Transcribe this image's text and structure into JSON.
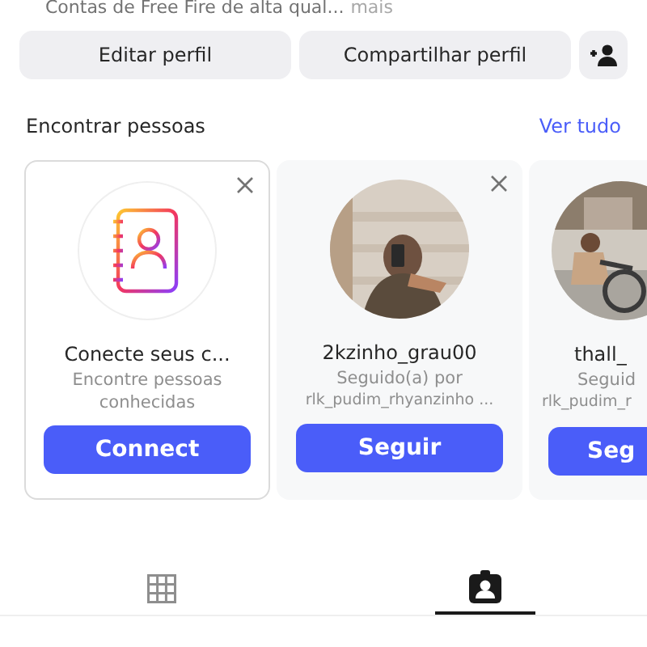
{
  "bio": {
    "text": "Contas de Free Fire de alta qual...",
    "more": "mais"
  },
  "profile_buttons": [
    "Editar perfil",
    "Compartilhar perfil"
  ],
  "section": {
    "title": "Encontrar pessoas",
    "link": "Ver tudo"
  },
  "cards": [
    {
      "kind": "contacts",
      "dismissible": true,
      "name": "Conecte seus c...",
      "subtitle": "Encontre pessoas conhecidas",
      "button": "Connect"
    },
    {
      "kind": "user",
      "dismissible": true,
      "name": "2kzinho_grau00",
      "subtitle": "Seguido(a) por",
      "detail": "rlk_pudim_rhyanzinho ...",
      "button": "Seguir"
    },
    {
      "kind": "partial",
      "name": "thall_",
      "subtitle": "Seguid",
      "detail": "rlk_pudim_r",
      "button": "Seg"
    }
  ],
  "tabs": [
    {
      "kind": "grid",
      "selected": false
    },
    {
      "kind": "tagged",
      "selected": true
    }
  ]
}
